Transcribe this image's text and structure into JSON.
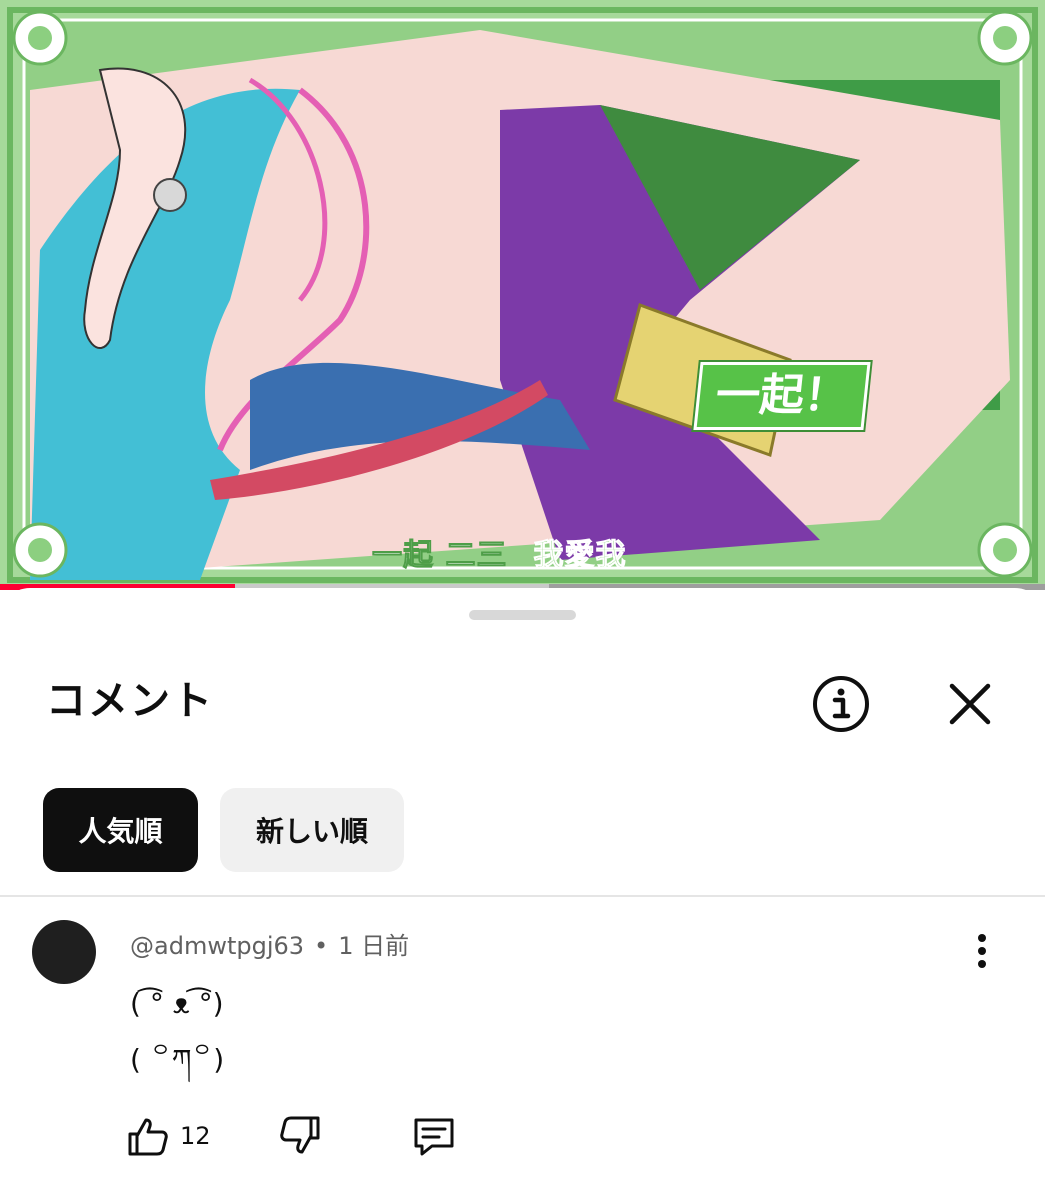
{
  "video": {
    "subtitle_white": "一起 二三",
    "subtitle_green": "我愛我",
    "badge_text": "一起！",
    "progress_played_pct": 22.5,
    "progress_buffered_pct": 52.5
  },
  "sheet": {
    "title": "コメント",
    "icons": {
      "info": "info-circle-icon",
      "close": "close-x-icon"
    },
    "sort_chips": [
      {
        "label": "人気順",
        "selected": true
      },
      {
        "label": "新しい順",
        "selected": false
      }
    ]
  },
  "comments": [
    {
      "author": "@admwtpgj63",
      "separator": "•",
      "time": "1 日前",
      "line1": "( ͡° ᴥ ͡°)",
      "line2": "( ꒪ཀ꒪)",
      "like_count": "12",
      "icons": {
        "like": "thumbs-up-icon",
        "dislike": "thumbs-down-icon",
        "reply": "reply-comment-icon",
        "more": "more-vertical-icon"
      }
    }
  ]
}
